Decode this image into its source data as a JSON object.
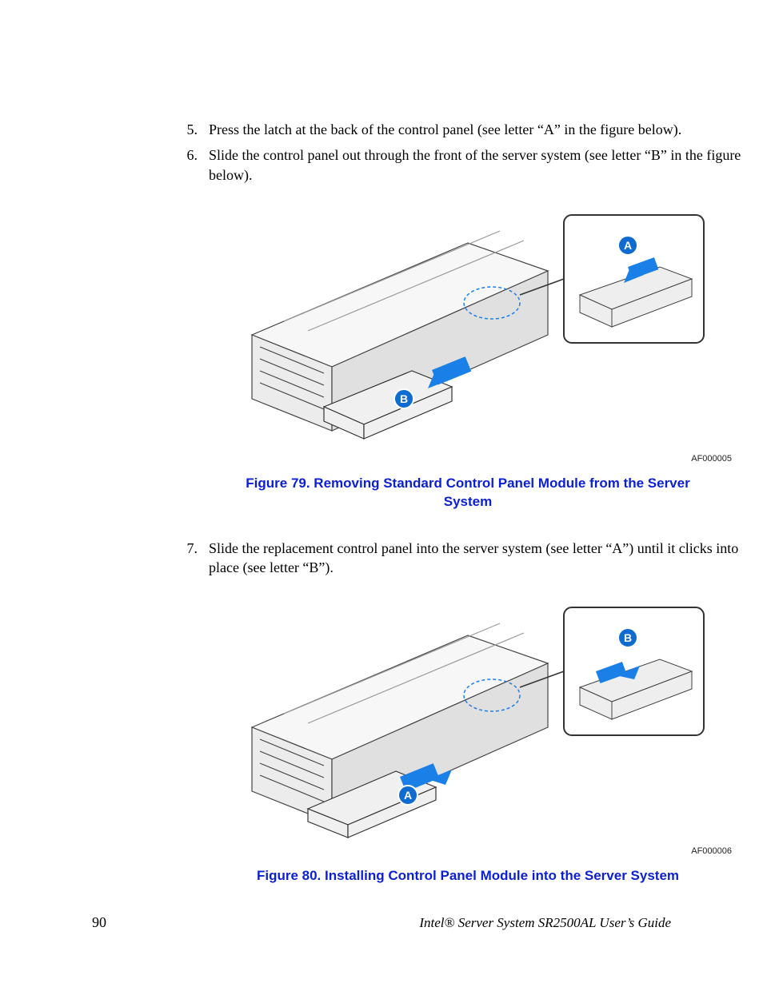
{
  "steps": {
    "s5": {
      "num": "5.",
      "text": "Press the latch at the back of the control panel (see letter “A” in the figure below)."
    },
    "s6": {
      "num": "6.",
      "text": "Slide the control panel out through the front of the server system (see letter “B” in the figure below)."
    },
    "s7": {
      "num": "7.",
      "text": "Slide the replacement control panel into the server system (see letter “A”) until it clicks into place (see letter “B”)."
    }
  },
  "figures": {
    "fig79": {
      "id": "AF000005",
      "caption": "Figure 79. Removing Standard Control Panel Module from the Server System",
      "labelA": "A",
      "labelB": "B"
    },
    "fig80": {
      "id": "AF000006",
      "caption": "Figure 80. Installing Control Panel Module into the Server System",
      "labelA": "A",
      "labelB": "B"
    }
  },
  "footer": {
    "page": "90",
    "guide": "Intel® Server System SR2500AL User’s Guide"
  },
  "colors": {
    "caption": "#0b1fd4",
    "label_fill": "#0f6bd0",
    "arrow": "#1b7fe8"
  }
}
